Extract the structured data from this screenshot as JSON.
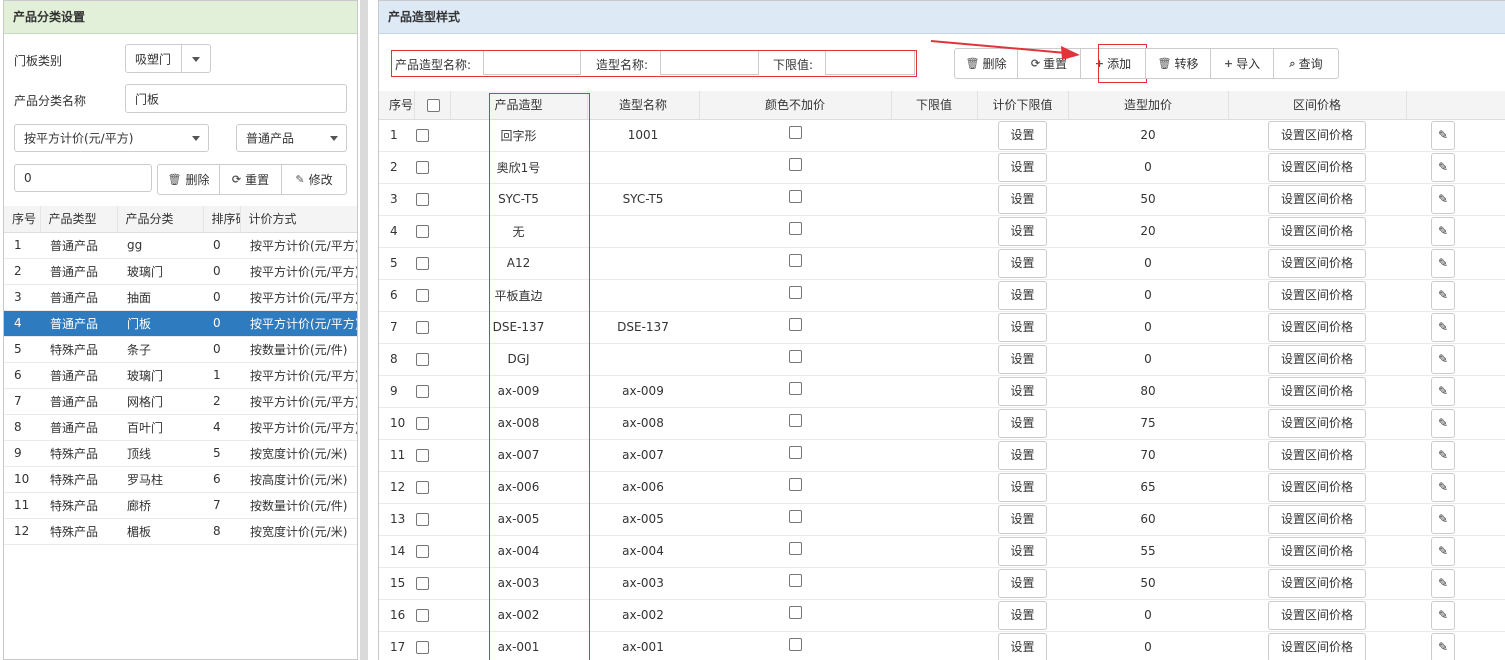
{
  "left": {
    "title": "产品分类设置",
    "door_type_label": "门板类别",
    "door_type_value": "吸塑门",
    "category_name_label": "产品分类名称",
    "category_name_value": "门板",
    "pricing_select": "按平方计价(元/平方)",
    "product_select": "普通产品",
    "sort_input": "0",
    "buttons": {
      "delete": "删除",
      "reset": "重置",
      "modify": "修改"
    },
    "columns": [
      "序号",
      "产品类型",
      "产品分类",
      "排序码",
      "计价方式"
    ],
    "rows": [
      [
        "1",
        "普通产品",
        "gg",
        "0",
        "按平方计价(元/平方)"
      ],
      [
        "2",
        "普通产品",
        "玻璃门",
        "0",
        "按平方计价(元/平方)"
      ],
      [
        "3",
        "普通产品",
        "抽面",
        "0",
        "按平方计价(元/平方)"
      ],
      [
        "4",
        "普通产品",
        "门板",
        "0",
        "按平方计价(元/平方)"
      ],
      [
        "5",
        "特殊产品",
        "条子",
        "0",
        "按数量计价(元/件)"
      ],
      [
        "6",
        "普通产品",
        "玻璃门",
        "1",
        "按平方计价(元/平方)"
      ],
      [
        "7",
        "普通产品",
        "网格门",
        "2",
        "按平方计价(元/平方)"
      ],
      [
        "8",
        "普通产品",
        "百叶门",
        "4",
        "按平方计价(元/平方)"
      ],
      [
        "9",
        "特殊产品",
        "顶线",
        "5",
        "按宽度计价(元/米)"
      ],
      [
        "10",
        "特殊产品",
        "罗马柱",
        "6",
        "按高度计价(元/米)"
      ],
      [
        "11",
        "特殊产品",
        "廊桥",
        "7",
        "按数量计价(元/件)"
      ],
      [
        "12",
        "特殊产品",
        "楣板",
        "8",
        "按宽度计价(元/米)"
      ]
    ],
    "selected_row": 3
  },
  "right": {
    "title": "产品造型样式",
    "filters": {
      "style_name_label": "产品造型名称:",
      "shape_name_label": "造型名称:",
      "lower_limit_label": "下限值:"
    },
    "toolbar": {
      "delete": "删除",
      "reset": "重置",
      "add": "添加",
      "move": "转移",
      "import": "导入",
      "query": "查询"
    },
    "columns": [
      "序号",
      "产品造型",
      "造型名称",
      "颜色不加价",
      "下限值",
      "计价下限值",
      "造型加价",
      "区间价格"
    ],
    "set_label": "设置",
    "set_range_label": "设置区间价格",
    "rows": [
      [
        "1",
        "回字形",
        "1001",
        "20"
      ],
      [
        "2",
        "奥欣1号",
        "",
        "0"
      ],
      [
        "3",
        "SYC-T5",
        "SYC-T5",
        "50"
      ],
      [
        "4",
        "无",
        "",
        "20"
      ],
      [
        "5",
        "A12",
        "",
        "0"
      ],
      [
        "6",
        "平板直边",
        "",
        "0"
      ],
      [
        "7",
        "DSE-137",
        "DSE-137",
        "0"
      ],
      [
        "8",
        "DGJ",
        "",
        "0"
      ],
      [
        "9",
        "ax-009",
        "ax-009",
        "80"
      ],
      [
        "10",
        "ax-008",
        "ax-008",
        "75"
      ],
      [
        "11",
        "ax-007",
        "ax-007",
        "70"
      ],
      [
        "12",
        "ax-006",
        "ax-006",
        "65"
      ],
      [
        "13",
        "ax-005",
        "ax-005",
        "60"
      ],
      [
        "14",
        "ax-004",
        "ax-004",
        "55"
      ],
      [
        "15",
        "ax-003",
        "ax-003",
        "50"
      ],
      [
        "16",
        "ax-002",
        "ax-002",
        "0"
      ],
      [
        "17",
        "ax-001",
        "ax-001",
        "0"
      ]
    ]
  },
  "colors": {
    "selected_row": "#2f7bbf",
    "annotation_red": "#e0343a"
  }
}
